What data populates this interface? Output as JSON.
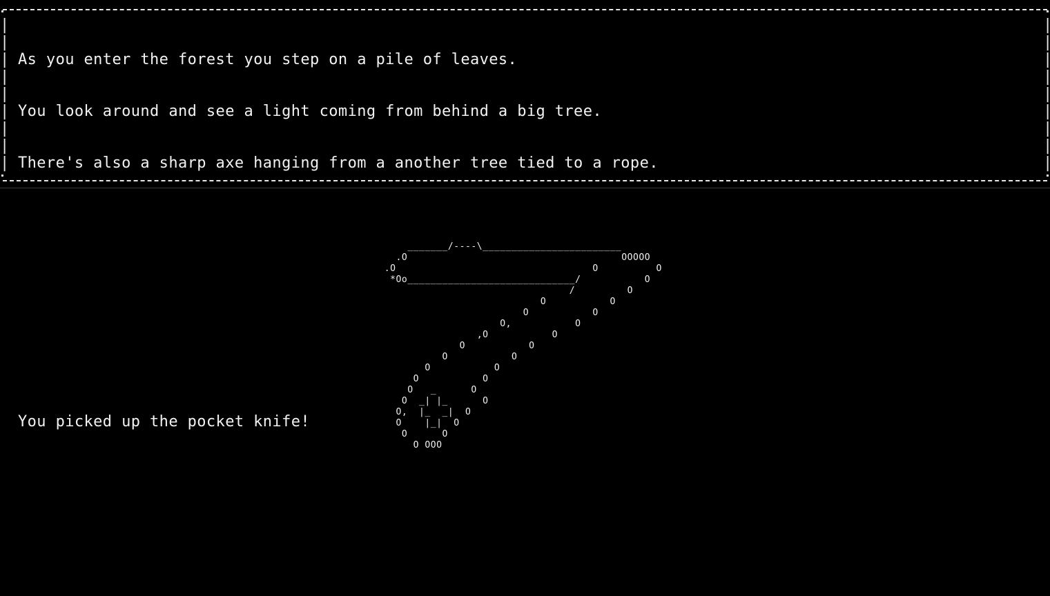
{
  "dialog": {
    "lines": [
      "As you enter the forest you step on a pile of leaves.",
      "You look around and see a light coming from behind a big tree.",
      "There's also a sharp axe hanging from a another tree tied to a rope.",
      "",
      "",
      "",
      "",
      "You picked up the pocket knife!",
      ""
    ]
  },
  "art": {
    "name": "pocket-knife-ascii-art",
    "text": "      _______/----\\________________________\n    .O                                     OOOOO\n  .O                                  O          O\n   *Oo_____________________________/           O\n                                  /         O\n                             O           O\n                          O           O\n                      O,           O\n                  ,O           O\n               O           O\n            O           O\n         O           O\n       O           O\n      O   _      O\n     O  _| |_      O\n    O,  |_  _|  O\n    O    |_|  O\n     O      O\n       O OOO"
  }
}
